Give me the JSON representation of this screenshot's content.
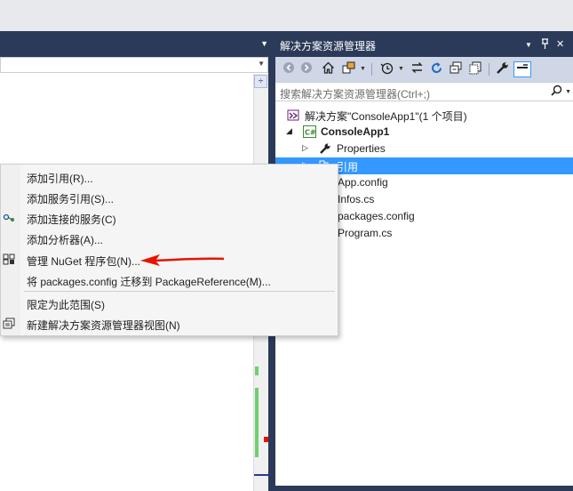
{
  "solution_explorer": {
    "title": "解决方案资源管理器",
    "controls": {
      "dropdown": "▾",
      "pin": "ᵖ",
      "close": "✕"
    },
    "search": {
      "placeholder": "搜索解决方案资源管理器(Ctrl+;)"
    },
    "toolbar": [
      "back-icon",
      "forward-icon",
      "home-icon",
      "switch-views-icon",
      "pending-changes-icon",
      "sync-icon",
      "refresh-icon",
      "collapse-all-icon",
      "show-all-files-icon",
      "properties-icon",
      "preview-icon"
    ],
    "tree": {
      "solution": "解决方案\"ConsoleApp1\"(1 个项目)",
      "project": "ConsoleApp1",
      "properties": "Properties",
      "references": "引用",
      "app_config": "App.config",
      "infos_cs": "Infos.cs",
      "packages_config": "packages.config",
      "program_cs": "Program.cs"
    }
  },
  "editor": {
    "split_glyph": "÷"
  },
  "context_menu": {
    "add_reference": "添加引用(R)...",
    "add_service_reference": "添加服务引用(S)...",
    "add_connected_service": "添加连接的服务(C)",
    "add_analyzer": "添加分析器(A)...",
    "manage_nuget": "管理 NuGet 程序包(N)...",
    "migrate_packages": "将 packages.config 迁移到 PackageReference(M)...",
    "scope_to_this": "限定为此范围(S)",
    "new_se_view": "新建解决方案资源管理器视图(N)"
  },
  "colors": {
    "panel_header": "#2b3a59",
    "selection": "#3399ff",
    "annotation_arrow": "#e51400"
  }
}
